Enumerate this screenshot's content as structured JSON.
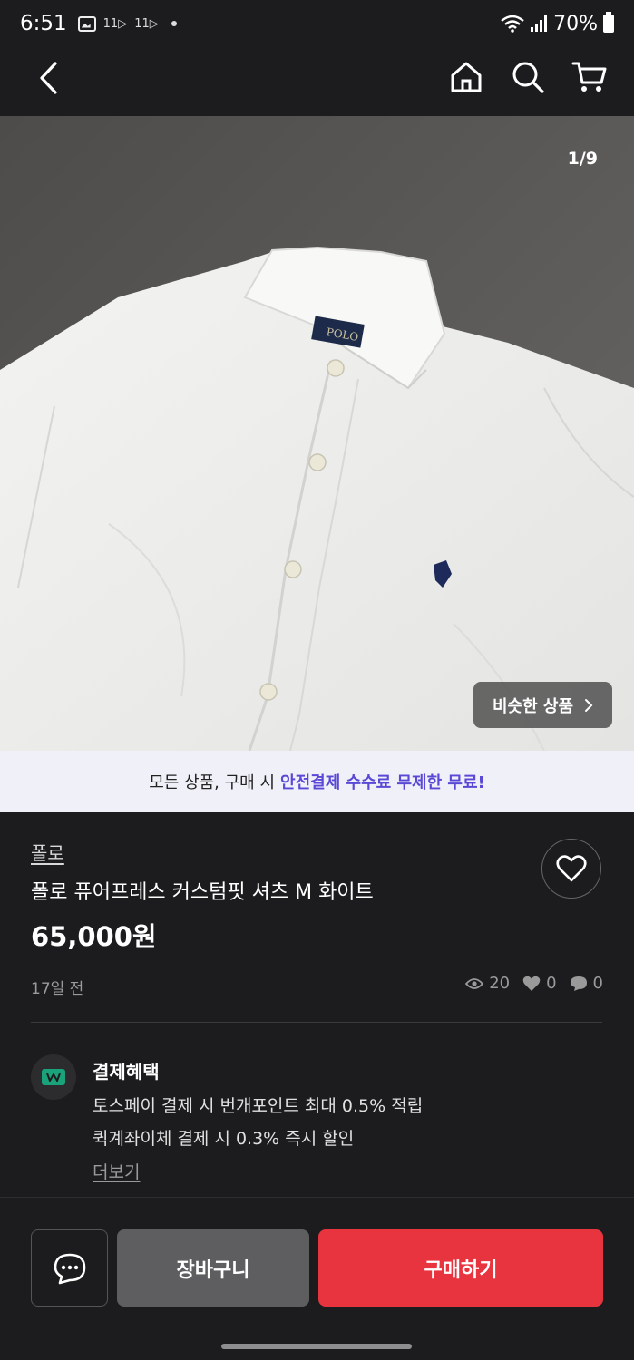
{
  "status_bar": {
    "time": "6:51",
    "notif_1": "11▷",
    "notif_2": "11▷",
    "battery_percent": "70%"
  },
  "app_bar": {
    "icons": [
      "back-icon",
      "home-icon",
      "search-icon",
      "cart-icon"
    ]
  },
  "image": {
    "counter": "1/9",
    "similar_label": "비슷한 상품",
    "logo_text": "POLO"
  },
  "promo": {
    "prefix": "모든 상품, 구매 시",
    "highlight": "안전결제 수수료 무제한 무료!"
  },
  "product": {
    "brand": "폴로",
    "title": "폴로 퓨어프레스 커스텀핏 셔츠 M 화이트",
    "price": "65,000원",
    "posted": "17일 전",
    "views": "20",
    "likes": "0",
    "chats": "0"
  },
  "benefit": {
    "title": "결제혜택",
    "line1": "토스페이 결제 시 번개포인트 최대 0.5% 적립",
    "line2": "퀵계좌이체 결제 시 0.3% 즉시 할인",
    "more": "더보기"
  },
  "actions": {
    "cart": "장바구니",
    "buy": "구매하기"
  },
  "colors": {
    "background": "#1c1c1e",
    "accent_purple": "#5a48d6",
    "buy_red": "#e8343f",
    "benefit_green": "#1aa37a"
  }
}
